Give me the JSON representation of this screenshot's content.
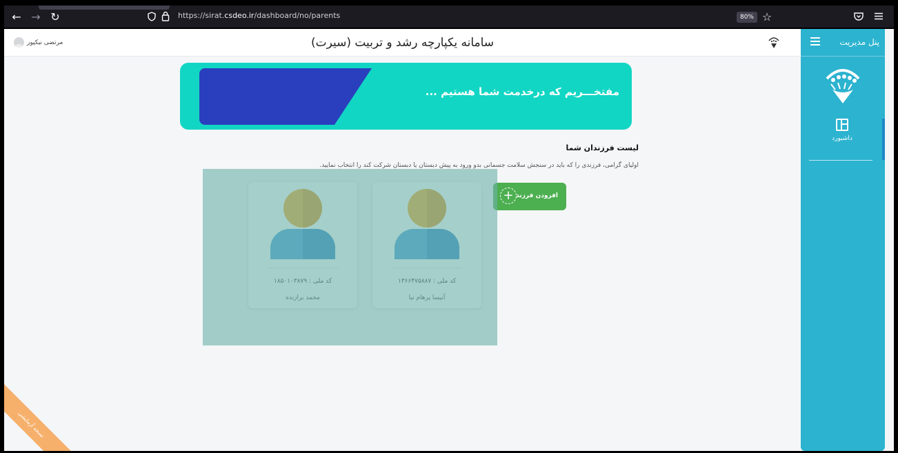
{
  "browser": {
    "url_prefix": "https://sirat.",
    "url_domain": "csdeo.ir",
    "url_path": "/dashboard/no/parents",
    "zoom": "80%"
  },
  "header": {
    "app_title": "سامانه یکپارچه رشد و تربیت (سیرت)",
    "user_name": "مرتضی نیکپور"
  },
  "sidebar": {
    "panel_title": "پنل مدیریت",
    "items": [
      {
        "label": "داشبورد",
        "icon": "dashboard-icon"
      }
    ]
  },
  "banner": {
    "text": "مفتخـــریم که درخدمت شما هستیم ...",
    "bg_color": "#12d6c4",
    "shape_color": "#2a3fbd"
  },
  "children_section": {
    "title": "لیست فرزندان شما",
    "description": "اولیای گرامی، فرزندی را که باید در سنجش سلامت جسمانی بدو ورود به پیش دبستان یا دبستان شرکت کند را انتخاب نمایید.",
    "add_button_label": "افزودن فرزند",
    "children": [
      {
        "national_id": "کد ملی : ۱۳۶۶۴۷۵۸۸۷",
        "name": "آنیسا پرهام نیا"
      },
      {
        "national_id": "کد ملی : ۱۸۵۰۱۰۳۸۷۹",
        "name": "محمد برازنده"
      }
    ]
  },
  "ribbon": {
    "text": "نسخه آزمایشی"
  },
  "colors": {
    "sidebar": "#2cb3cf",
    "add_button": "#4caf50",
    "overlay": "#6eb2aa"
  }
}
